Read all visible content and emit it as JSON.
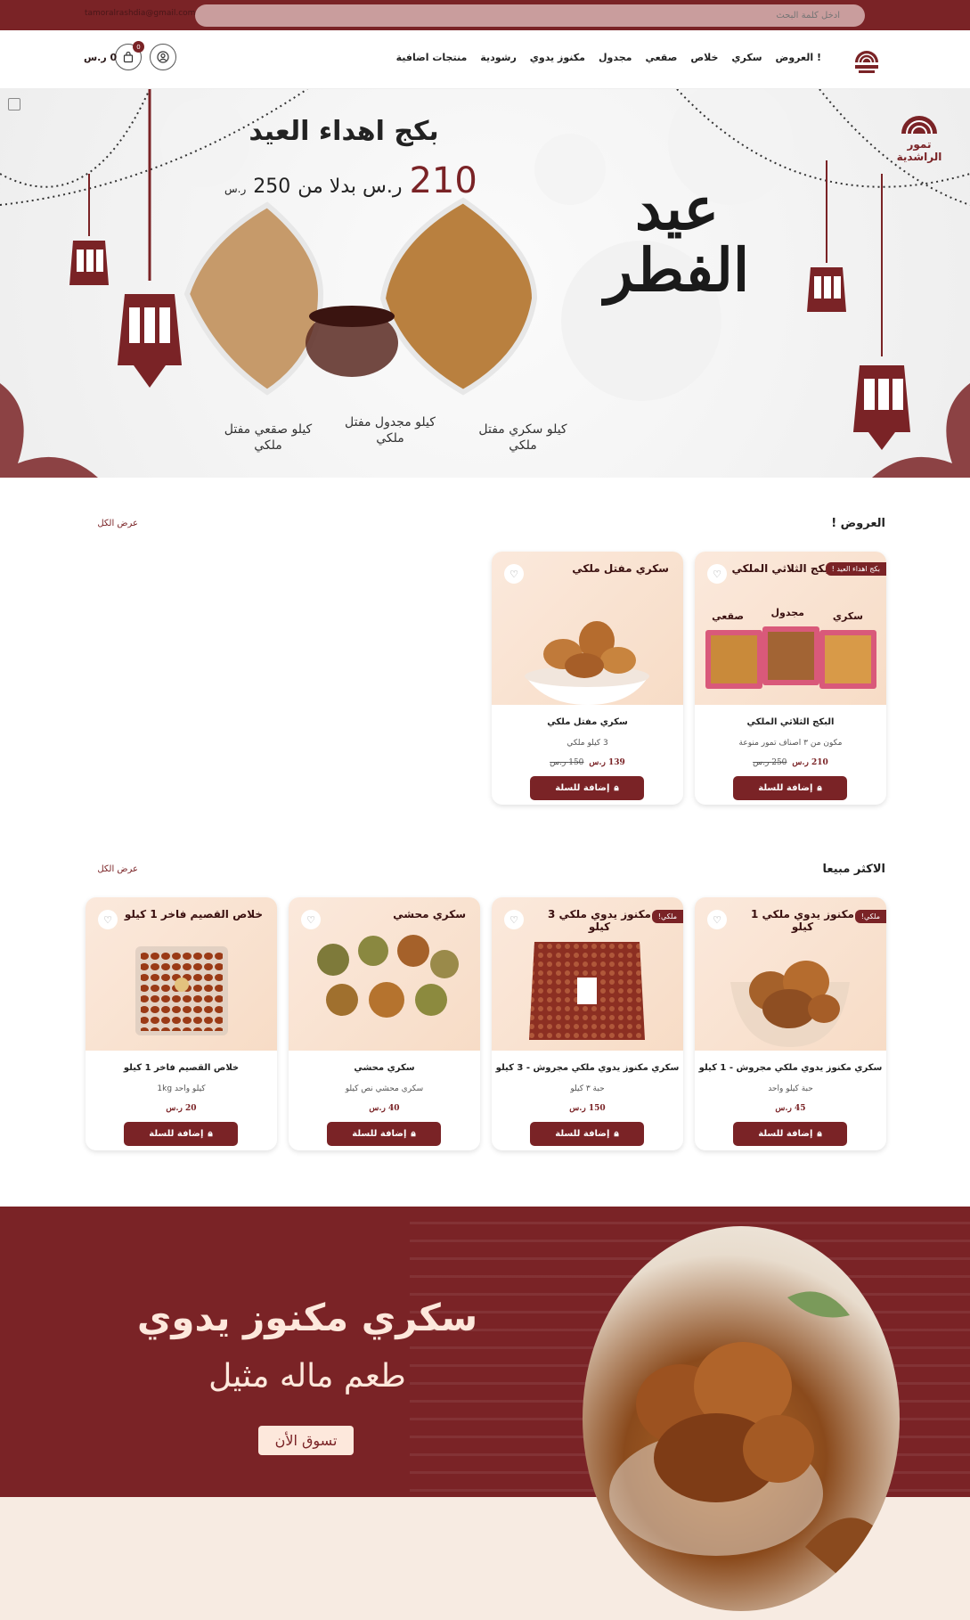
{
  "topbar": {
    "search_placeholder": "ادخل كلمة البحث",
    "email": "tamoralrashdia@gmail.com"
  },
  "nav": {
    "menu": [
      "العروض !",
      "سكري",
      "خلاص",
      "صقعي",
      "مجدول",
      "مكنوز يدوي",
      "رشودية",
      "منتجات اضافية"
    ],
    "cart_count": "0",
    "cart_total": "0 ر.س",
    "logo_text": "تمور الراشدية"
  },
  "hero": {
    "title": "بكج اهداء العيد",
    "new_price": "210",
    "price_text": "ر.س بدلا من",
    "old_price": "250",
    "currency": "ر.س",
    "eid_line1": "عيد",
    "eid_line2": "الفطر",
    "logo_line1": "تمور",
    "logo_line2": "الراشدية",
    "captions": [
      "كيلو صقعي مفتل ملكي",
      "كيلو مجدول مفتل ملكي",
      "كيلو سكري مفتل ملكي"
    ]
  },
  "offers": {
    "title": "العروض !",
    "view_all": "عرض الكل",
    "products": [
      {
        "label": "البكج الثلاثي الملكي",
        "tag": "بكج اهداء العيد !",
        "name": "البكج الثلاثي الملكي",
        "desc": "مكون من ٣ اصناف تمور منوعة",
        "price": "210 ر.س",
        "old": "250 ر.س",
        "btn": "إضافة للسلة",
        "box_labels": [
          "صقعي",
          "مجدول",
          "سكري"
        ]
      },
      {
        "label": "سكري مفتل ملكي",
        "tag": "",
        "name": "سكري مفتل ملكي",
        "desc": "3 كيلو ملكي",
        "price": "139 ر.س",
        "old": "150 ر.س",
        "btn": "إضافة للسلة"
      }
    ]
  },
  "bestsellers": {
    "title": "الاكثر مبيعا",
    "view_all": "عرض الكل",
    "products": [
      {
        "label": "مكنوز يدوي ملكي 1 كيلو",
        "tag": "ملكي!",
        "name": "سكري مكنوز يدوي ملكي مجروش - 1 كيلو",
        "desc": "حبة كيلو واحد",
        "price": "45 ر.س",
        "btn": "إضافة للسلة"
      },
      {
        "label": "مكنوز يدوي ملكي 3 كيلو",
        "tag": "ملكي!",
        "name": "سكري مكنوز يدوي ملكي مجروش - 3 كيلو",
        "desc": "حبة ٣ كيلو",
        "price": "150 ر.س",
        "btn": "إضافة للسلة"
      },
      {
        "label": "سكري محشي",
        "tag": "",
        "name": "سكري محشي",
        "desc": "سكري محشي نص كيلو",
        "price": "40 ر.س",
        "btn": "إضافة للسلة"
      },
      {
        "label": "خلاص القصيم فاخر 1 كيلو",
        "tag": "",
        "name": "خلاص القصيم فاخر 1 كيلو",
        "desc": "كيلو واحد 1kg",
        "price": "20 ر.س",
        "btn": "إضافة للسلة"
      }
    ]
  },
  "banner": {
    "title": "سكري مكنوز يدوي",
    "subtitle": "طعم ماله مثيل",
    "cta": "تسوق الأن"
  },
  "colors": {
    "brand": "#7a2326",
    "cream": "#fde8dc"
  }
}
